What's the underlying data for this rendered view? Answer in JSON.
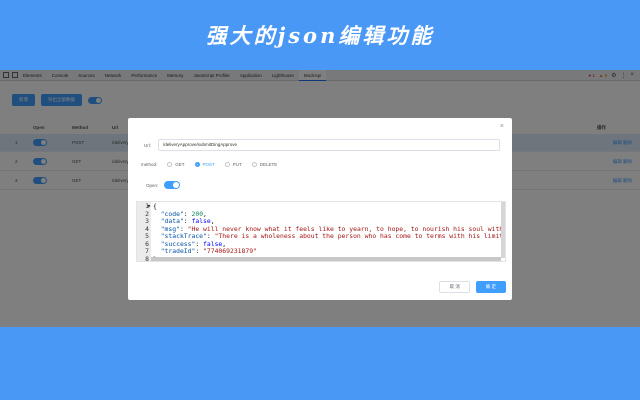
{
  "banner": {
    "title": "强大的json编辑功能"
  },
  "devtools": {
    "tabs": [
      "Elements",
      "Console",
      "Sources",
      "Network",
      "Performance",
      "Memory",
      "JavaScript Profiler",
      "Application",
      "Lighthouse",
      "MockApi"
    ],
    "active_tab": "MockApi",
    "errors": "1",
    "warnings": "5"
  },
  "toolbar": {
    "add_label": "新增",
    "import_label": "导出全部数据"
  },
  "table": {
    "columns": {
      "index": "",
      "open": "Open",
      "method": "Method",
      "url": "Url",
      "actions": "操作"
    },
    "rows": [
      {
        "index": "1",
        "method": "POST",
        "url": "/deliveryApprove/submitDingApprove",
        "actions": "编辑 删除"
      },
      {
        "index": "2",
        "method": "GET",
        "url": "/deliveryApprove/getList",
        "actions": "编辑 删除"
      },
      {
        "index": "3",
        "method": "GET",
        "url": "/deliveryApprove/getDetail",
        "actions": "编辑 删除"
      }
    ]
  },
  "dialog": {
    "close": "×",
    "url_label": "Url:",
    "url_value": "/deliveryApprove/submitDingApprove",
    "method_label": "method:",
    "methods": [
      "GET",
      "POST",
      "PUT",
      "DELETE"
    ],
    "selected_method": "POST",
    "open_label": "Open:",
    "lines": [
      {
        "n": "1",
        "fold": "▾",
        "open": "{"
      },
      {
        "n": "2",
        "key": "\"code\"",
        "val": "200",
        "vtype": "num"
      },
      {
        "n": "3",
        "key": "\"data\"",
        "val": "false",
        "vtype": "kw"
      },
      {
        "n": "4",
        "key": "\"msg\"",
        "val": "\"He will never know what it feels like to yearn, to hope, to nourish his soul with the",
        "vtype": "str"
      },
      {
        "n": "5",
        "key": "\"stackTrace\"",
        "val": "\"There is a wholeness about the person who has come to terms with his limitatio",
        "vtype": "str"
      },
      {
        "n": "6",
        "key": "\"success\"",
        "val": "false",
        "vtype": "kw"
      },
      {
        "n": "7",
        "key": "\"tradeId\"",
        "val": "\"774069231879\"",
        "vtype": "str"
      },
      {
        "n": "8",
        "close": "}"
      }
    ],
    "cancel_label": "取 消",
    "ok_label": "确 定"
  }
}
